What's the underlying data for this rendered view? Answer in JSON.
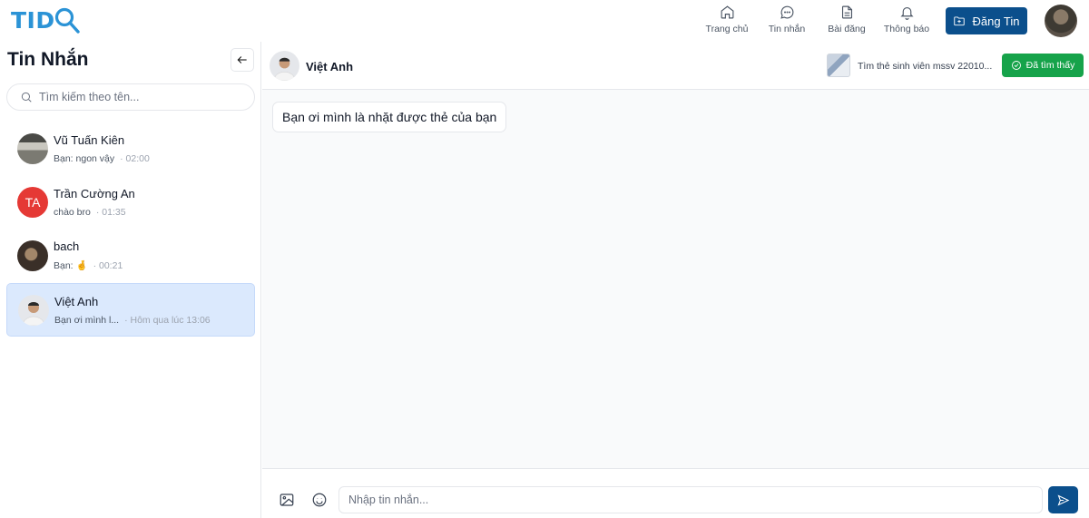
{
  "brand": {
    "logo_text": "TID",
    "color": "#2b93d6"
  },
  "nav": [
    {
      "label": "Trang chủ",
      "icon": "home-icon"
    },
    {
      "label": "Tin nhắn",
      "icon": "message-circle-icon"
    },
    {
      "label": "Bài đăng",
      "icon": "document-icon"
    },
    {
      "label": "Thông báo",
      "icon": "bell-icon"
    }
  ],
  "post_button": {
    "label": "Đăng Tin",
    "icon": "folder-plus-icon",
    "color": "#0b4f8c"
  },
  "sidebar": {
    "title": "Tin Nhắn",
    "back_icon": "arrow-left-icon",
    "search_placeholder": "Tìm kiếm theo tên...",
    "conversations": [
      {
        "name": "Vũ Tuấn Kiên",
        "preview": "Bạn: ngon vậy",
        "time": "· 02:00",
        "active": false
      },
      {
        "name": "Trần Cường An",
        "preview": "chào bro",
        "time": "· 01:35",
        "active": false,
        "initials": "TA",
        "avatar_color": "#e53935"
      },
      {
        "name": "bach",
        "preview": "Bạn: 🤞",
        "time": "· 00:21",
        "active": false
      },
      {
        "name": "Việt Anh",
        "preview": "Bạn ơi mình l...",
        "time": "· Hôm qua lúc 13:06",
        "active": true
      }
    ]
  },
  "chat": {
    "contact_name": "Việt Anh",
    "post_title": "Tìm thẻ sinh viên mssv 22010...",
    "found_label": "Đã tìm thấy",
    "found_color": "#16a34a",
    "messages": [
      {
        "text": "Bạn ơi mình là nhặt được thẻ của bạn",
        "from": "other"
      }
    ],
    "input_placeholder": "Nhập tin nhắn..."
  }
}
